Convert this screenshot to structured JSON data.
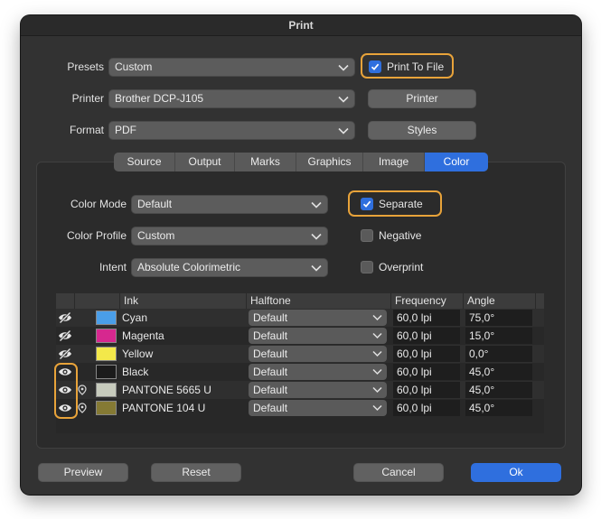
{
  "window": {
    "title": "Print"
  },
  "presets": {
    "label": "Presets",
    "value": "Custom"
  },
  "printer": {
    "label": "Printer",
    "value": "Brother DCP-J105",
    "button": "Printer"
  },
  "format": {
    "label": "Format",
    "value": "PDF",
    "button": "Styles"
  },
  "print_to_file": {
    "label": "Print To File",
    "checked": true
  },
  "tabs": [
    {
      "label": "Source"
    },
    {
      "label": "Output"
    },
    {
      "label": "Marks"
    },
    {
      "label": "Graphics"
    },
    {
      "label": "Image"
    },
    {
      "label": "Color",
      "active": true
    }
  ],
  "color": {
    "mode_label": "Color Mode",
    "mode_value": "Default",
    "profile_label": "Color Profile",
    "profile_value": "Custom",
    "intent_label": "Intent",
    "intent_value": "Absolute Colorimetric",
    "separate_label": "Separate",
    "separate_checked": true,
    "negative_label": "Negative",
    "negative_checked": false,
    "overprint_label": "Overprint",
    "overprint_checked": false
  },
  "table": {
    "headers": {
      "ink": "Ink",
      "halftone": "Halftone",
      "frequency": "Frequency",
      "angle": "Angle"
    },
    "rows": [
      {
        "visible": false,
        "spot": false,
        "swatch": "#4a9ee8",
        "ink": "Cyan",
        "halftone": "Default",
        "frequency": "60,0 lpi",
        "angle": "75,0°"
      },
      {
        "visible": false,
        "spot": false,
        "swatch": "#d6288f",
        "ink": "Magenta",
        "halftone": "Default",
        "frequency": "60,0 lpi",
        "angle": "15,0°"
      },
      {
        "visible": false,
        "spot": false,
        "swatch": "#f3e84a",
        "ink": "Yellow",
        "halftone": "Default",
        "frequency": "60,0 lpi",
        "angle": "0,0°"
      },
      {
        "visible": true,
        "spot": false,
        "swatch": "#1b1b1b",
        "ink": "Black",
        "halftone": "Default",
        "frequency": "60,0 lpi",
        "angle": "45,0°"
      },
      {
        "visible": true,
        "spot": true,
        "swatch": "#c7cbbd",
        "ink": "PANTONE 5665 U",
        "halftone": "Default",
        "frequency": "60,0 lpi",
        "angle": "45,0°"
      },
      {
        "visible": true,
        "spot": true,
        "swatch": "#857a34",
        "ink": "PANTONE 104 U",
        "halftone": "Default",
        "frequency": "60,0 lpi",
        "angle": "45,0°"
      }
    ]
  },
  "buttons": {
    "preview": "Preview",
    "reset": "Reset",
    "cancel": "Cancel",
    "ok": "Ok"
  },
  "colors": {
    "accent": "#2f6fde",
    "highlight": "#e8a33a",
    "window_bg": "#323232"
  },
  "icons": {
    "visible": "eye-icon",
    "hidden": "eye-slash-icon",
    "spot": "spot-ink-icon",
    "dropdown": "chevron-down-icon",
    "check": "checkmark-icon"
  }
}
